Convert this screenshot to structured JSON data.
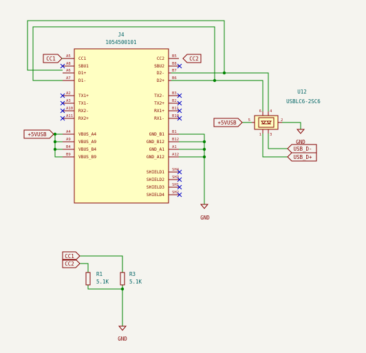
{
  "j4": {
    "ref": "J4",
    "value": "1054500101",
    "left_pins": [
      {
        "num": "A5",
        "name": "CC1"
      },
      {
        "num": "A8",
        "name": "SBU1"
      },
      {
        "num": "A6",
        "name": "D1+"
      },
      {
        "num": "A7",
        "name": "D1-"
      },
      {
        "num": "A2",
        "name": "TX1+"
      },
      {
        "num": "A3",
        "name": "TX1-"
      },
      {
        "num": "A10",
        "name": "RX2-"
      },
      {
        "num": "A11",
        "name": "RX2+"
      },
      {
        "num": "A4",
        "name": "VBUS_A4"
      },
      {
        "num": "A9",
        "name": "VBUS_A9"
      },
      {
        "num": "B4",
        "name": "VBUS_B4"
      },
      {
        "num": "B9",
        "name": "VBUS_B9"
      }
    ],
    "right_pins": [
      {
        "num": "B5",
        "name": "CC2"
      },
      {
        "num": "B8",
        "name": "SBU2"
      },
      {
        "num": "B7",
        "name": "D2-"
      },
      {
        "num": "B6",
        "name": "D2+"
      },
      {
        "num": "B3",
        "name": "TX2-"
      },
      {
        "num": "B2",
        "name": "TX2+"
      },
      {
        "num": "B11",
        "name": "RX1+"
      },
      {
        "num": "B10",
        "name": "RX1-"
      },
      {
        "num": "B1",
        "name": "GND_B1"
      },
      {
        "num": "B12",
        "name": "GND_B12"
      },
      {
        "num": "A1",
        "name": "GND_A1"
      },
      {
        "num": "A12",
        "name": "GND_A12"
      },
      {
        "num": "SH4",
        "name": "SHIELD1"
      },
      {
        "num": "SH3",
        "name": "SHIELD2"
      },
      {
        "num": "SH1",
        "name": "SHIELD3"
      },
      {
        "num": "SH2",
        "name": "SHIELD4"
      }
    ]
  },
  "u12": {
    "ref": "U12",
    "value": "USBLC6-2SC6",
    "pins": {
      "p5": "5",
      "p2": "2",
      "p6": "6",
      "p4": "4",
      "p1": "1",
      "p3": "3"
    }
  },
  "labels": {
    "cc1": "CC1",
    "cc2": "CC2",
    "vusb_j4": "+5VUSB",
    "vusb_u12": "+5VUSB",
    "usb_dm": "USB_D-",
    "usb_dp": "USB_D+",
    "cc1_b": "CC1",
    "cc2_b": "CC2"
  },
  "power": {
    "gnd_j4": "GND",
    "gnd_u12": "GND",
    "gnd_res": "GND"
  },
  "r1": {
    "ref": "R1",
    "value": "5.1K"
  },
  "r3": {
    "ref": "R3",
    "value": "5.1K"
  }
}
